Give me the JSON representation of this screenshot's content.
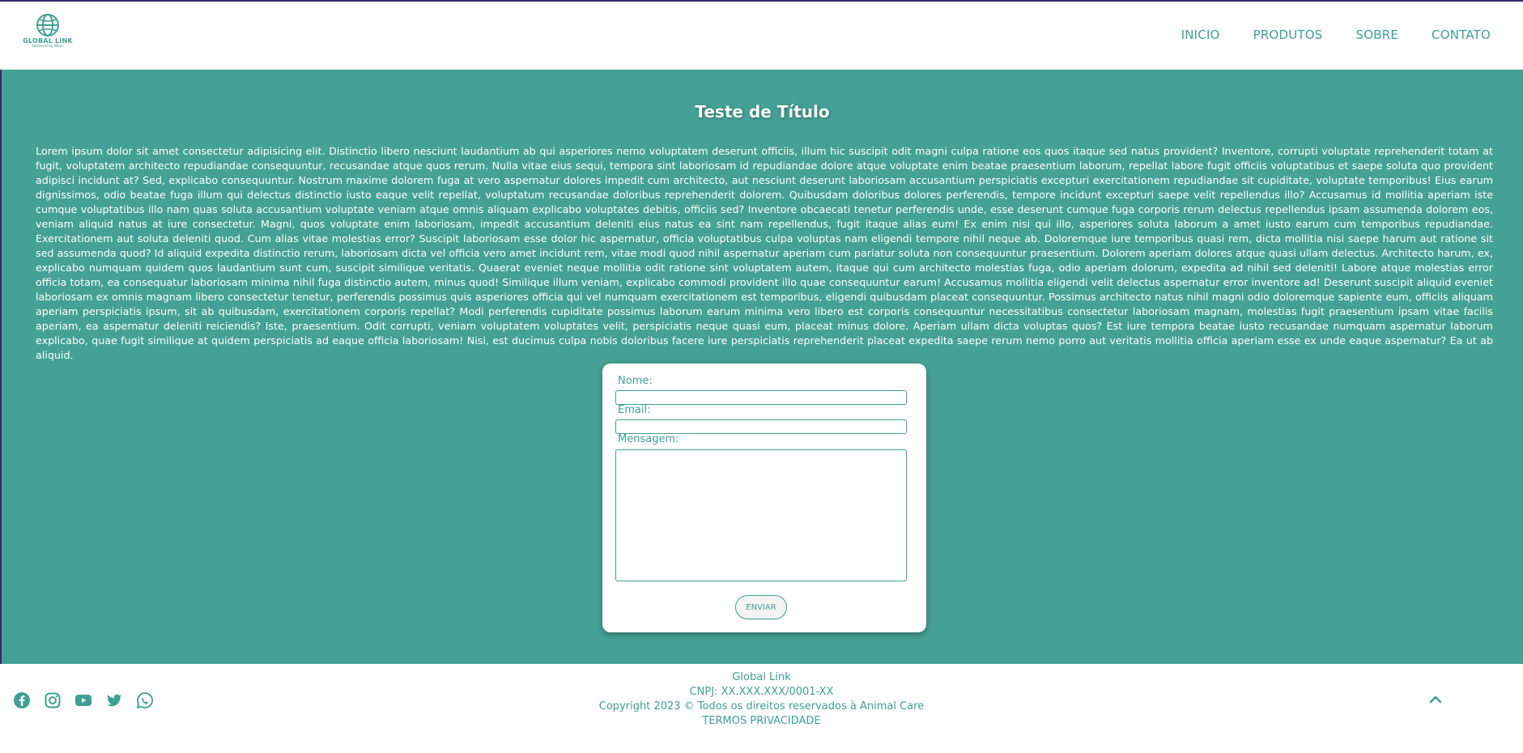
{
  "header": {
    "logo_name": "GLOBAL LINK",
    "logo_tag": "Networking Ways",
    "nav": [
      "INICIO",
      "PRODUTOS",
      "SOBRE",
      "CONTATO"
    ]
  },
  "main": {
    "title": "Teste de Título",
    "body": "Lorem ipsum dolor sit amet consectetur adipisicing elit. Distinctio libero nesciunt laudantium ab qui asperiores nemo voluptatem deserunt officiis, illum hic suscipit odit magni culpa ratione eos quos itaque sed natus provident? Inventore, corrupti voluptate reprehenderit totam at fugit, voluptatem architecto repudiandae consequuntur, recusandae atque quos rerum. Nulla vitae eius sequi, tempora sint laboriosam id repudiandae dolore atque voluptate enim beatae praesentium laborum, repellat labore fugit officiis voluptatibus et saepe soluta quo provident adipisci incidunt at? Sed, explicabo consequuntur. Nostrum maxime dolorem fuga at vero aspernatur dolores impedit cum architecto, aut nesciunt deserunt laboriosam accusantium perspiciatis excepturi exercitationem repudiandae sit cupiditate, voluptate temporibus! Eius earum dignissimos, odio beatae fuga illum qui delectus distinctio iusto eaque velit repellat, voluptatum recusandae doloribus reprehenderit dolorem. Quibusdam doloribus dolores perferendis, tempore incidunt excepturi saepe velit repellendus illo? Accusamus id mollitia aperiam iste cumque voluptatibus illo nam quas soluta accusantium voluptate veniam atque omnis aliquam explicabo voluptates debitis, officiis sed? Inventore obcaecati tenetur perferendis unde, esse deserunt cumque fuga corporis rerum delectus repellendus ipsam assumenda dolorem eos, veniam aliquid natus at iure consectetur. Magni, quos voluptate enim laboriosam, impedit accusantium deleniti eius natus ea sint nam repellendus, fugit itaque alias eum! Ex enim nisi qui illo, asperiores soluta laborum a amet iusto earum cum temporibus repudiandae. Exercitationem aut soluta deleniti quod. Cum alias vitae molestias error? Suscipit laboriosam esse dolor hic aspernatur, officia voluptatibus culpa voluptas nam eligendi tempore nihil neque ab. Doloremque iure temporibus quasi rem, dicta mollitia nisi saepe harum aut ratione sit sed assumenda quod? Id aliquid expedita distinctio rerum, laboriosam dicta vel officia vero amet incidunt rem, vitae modi quod nihil aspernatur aperiam cum pariatur soluta non consequuntur praesentium. Dolorem aperiam dolores atque quasi ullam delectus. Architecto harum, ex, explicabo numquam quidem quos laudantium sunt cum, suscipit similique veritatis. Quaerat eveniet neque mollitia odit ratione sint voluptatem autem, itaque qui cum architecto molestias fuga, odio aperiam dolorum, expedita ad nihil sed deleniti! Labore atque molestias error officia totam, ea consequatur laboriosam minima nihil fuga distinctio autem, minus quod! Similique illum veniam, explicabo commodi provident illo quae consequuntur earum! Accusamus mollitia eligendi velit delectus aspernatur error inventore ad! Deserunt suscipit aliquid eveniet laboriosam ex omnis magnam libero consectetur tenetur, perferendis possimus quis asperiores officia qui vel numquam exercitationem est temporibus, eligendi quibusdam placeat consequuntur. Possimus architecto natus nihil magni odio doloremque sapiente eum, officiis aliquam aperiam perspiciatis ipsum, sit ab quibusdam, exercitationem corporis repellat? Modi perferendis cupiditate possimus laborum earum minima vero libero est corporis consequuntur necessitatibus consectetur laboriosam magnam, molestias fugit praesentium ipsam vitae facilis aperiam, ea aspernatur deleniti reiciendis? Iste, praesentium. Odit corrupti, veniam voluptatem voluptates velit, perspiciatis neque quasi eum, placeat minus dolore. Aperiam ullam dicta voluptas quos? Est iure tempora beatae iusto recusandae numquam aspernatur laborum explicabo, quae fugit similique at quidem perspiciatis ad eaque officia laboriosam! Nisi, est ducimus culpa nobis doloribus facere iure perspiciatis reprehenderit placeat expedita saepe rerum nemo porro aut veritatis mollitia officia aperiam esse ex unde eaque aspernatur? Ea ut ab aliquid."
  },
  "form": {
    "name_label": "Nome:",
    "name_value": "",
    "email_label": "Email:",
    "email_value": "",
    "message_label": "Mensagem:",
    "message_value": "",
    "submit_label": "ENVIAR"
  },
  "footer": {
    "company": "Global Link",
    "cnpj": "CNPJ: XX.XXX.XXX/0001-XX",
    "copyright": "Copyright 2023 © Todos os direitos reservados à Animal Care",
    "links": "TERMOS PRIVACIDADE",
    "social_icons": [
      "facebook-icon",
      "instagram-icon",
      "youtube-icon",
      "twitter-icon",
      "whatsapp-icon"
    ]
  },
  "colors": {
    "brand": "#3f9f93",
    "main_bg": "#45a195"
  }
}
